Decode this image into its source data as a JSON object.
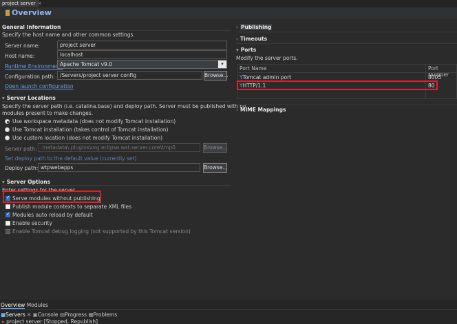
{
  "editor": {
    "tab_label": "project server",
    "tab_close": "×",
    "title": "Overview"
  },
  "general": {
    "heading": "General Information",
    "description": "Specify the host name and other common settings.",
    "server_name_label": "Server name:",
    "server_name_value": "project server",
    "host_name_label": "Host name:",
    "host_name_value": "localhost",
    "runtime_label": "Runtime Environment:",
    "runtime_value": "Apache Tomcat v9.0",
    "config_path_label": "Configuration path:",
    "config_path_value": "/Servers/project server config",
    "browse_label": "Browse...",
    "open_launch_link": "Open launch configuration"
  },
  "locations": {
    "heading": "Server Locations",
    "description_line1": "Specify the server path (i.e. catalina.base) and deploy path. Server must be published with no",
    "description_line2": "modules present to make changes.",
    "options": [
      "Use workspace metadata (does not modify Tomcat installation)",
      "Use Tomcat installation (takes control of Tomcat installation)",
      "Use custom location (does not modify Tomcat installation)"
    ],
    "selected_index": 0,
    "server_path_label": "Server path:",
    "server_path_value": ".metadata\\.plugins\\org.eclipse.wst.server.core\\tmp0",
    "browse_label": "Browse...",
    "set_default_link": "Set deploy path to the default value (currently set)",
    "deploy_path_label": "Deploy path:",
    "deploy_path_value": "wtpwebapps",
    "deploy_browse_label": "Browse..."
  },
  "options": {
    "heading": "Server Options",
    "description": "Enter settings for the server.",
    "items": [
      {
        "label": "Serve modules without publishing",
        "checked": true
      },
      {
        "label": "Publish module contexts to separate XML files",
        "checked": false
      },
      {
        "label": "Modules auto reload by default",
        "checked": true
      },
      {
        "label": "Enable security",
        "checked": false
      },
      {
        "label": "Enable Tomcat debug logging (not supported by this Tomcat version)",
        "checked": false
      }
    ]
  },
  "right": {
    "publishing": "Publishing",
    "timeouts": "Timeouts",
    "ports_heading": "Ports",
    "ports_description": "Modify the server ports.",
    "ports_header_name": "Port Name",
    "ports_header_number": "Port Number",
    "ports_rows": [
      {
        "name": "Tomcat admin port",
        "number": "8005"
      },
      {
        "name": "HTTP/1.1",
        "number": "80"
      }
    ],
    "mime": "MIME Mappings"
  },
  "bottom": {
    "overview_tab": "Overview",
    "modules_tab": "Modules",
    "servers_tab": "Servers",
    "console_tab": "Console",
    "progress_tab": "Progress",
    "problems_tab": "Problems",
    "server_entry": "project server  [Stopped, Republish]"
  },
  "colors": {
    "highlight_box": "#e0202a",
    "link": "#6da2e6",
    "title": "#8fb9ee"
  }
}
